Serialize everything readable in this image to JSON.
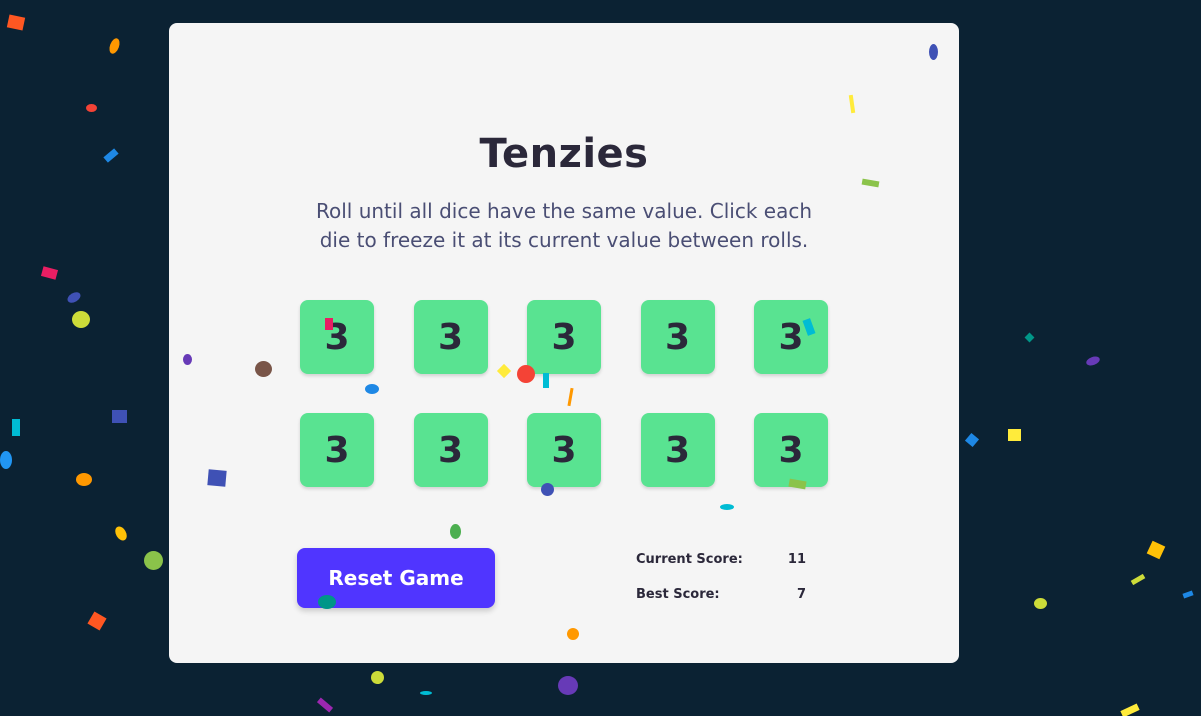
{
  "game": {
    "title": "Tenzies",
    "instructions": "Roll until all dice have the same value. Click each die to freeze it at its current value between rolls."
  },
  "dice": [
    "3",
    "3",
    "3",
    "3",
    "3",
    "3",
    "3",
    "3",
    "3",
    "3"
  ],
  "controls": {
    "reset_label": "Reset Game"
  },
  "scores": {
    "current_label": "Current Score:",
    "current_value": "11",
    "best_label": "Best Score:",
    "best_value": "7"
  },
  "colors": {
    "background": "#0b2233",
    "card": "#f5f5f5",
    "die_held": "#59e391",
    "button": "#5035ff"
  }
}
